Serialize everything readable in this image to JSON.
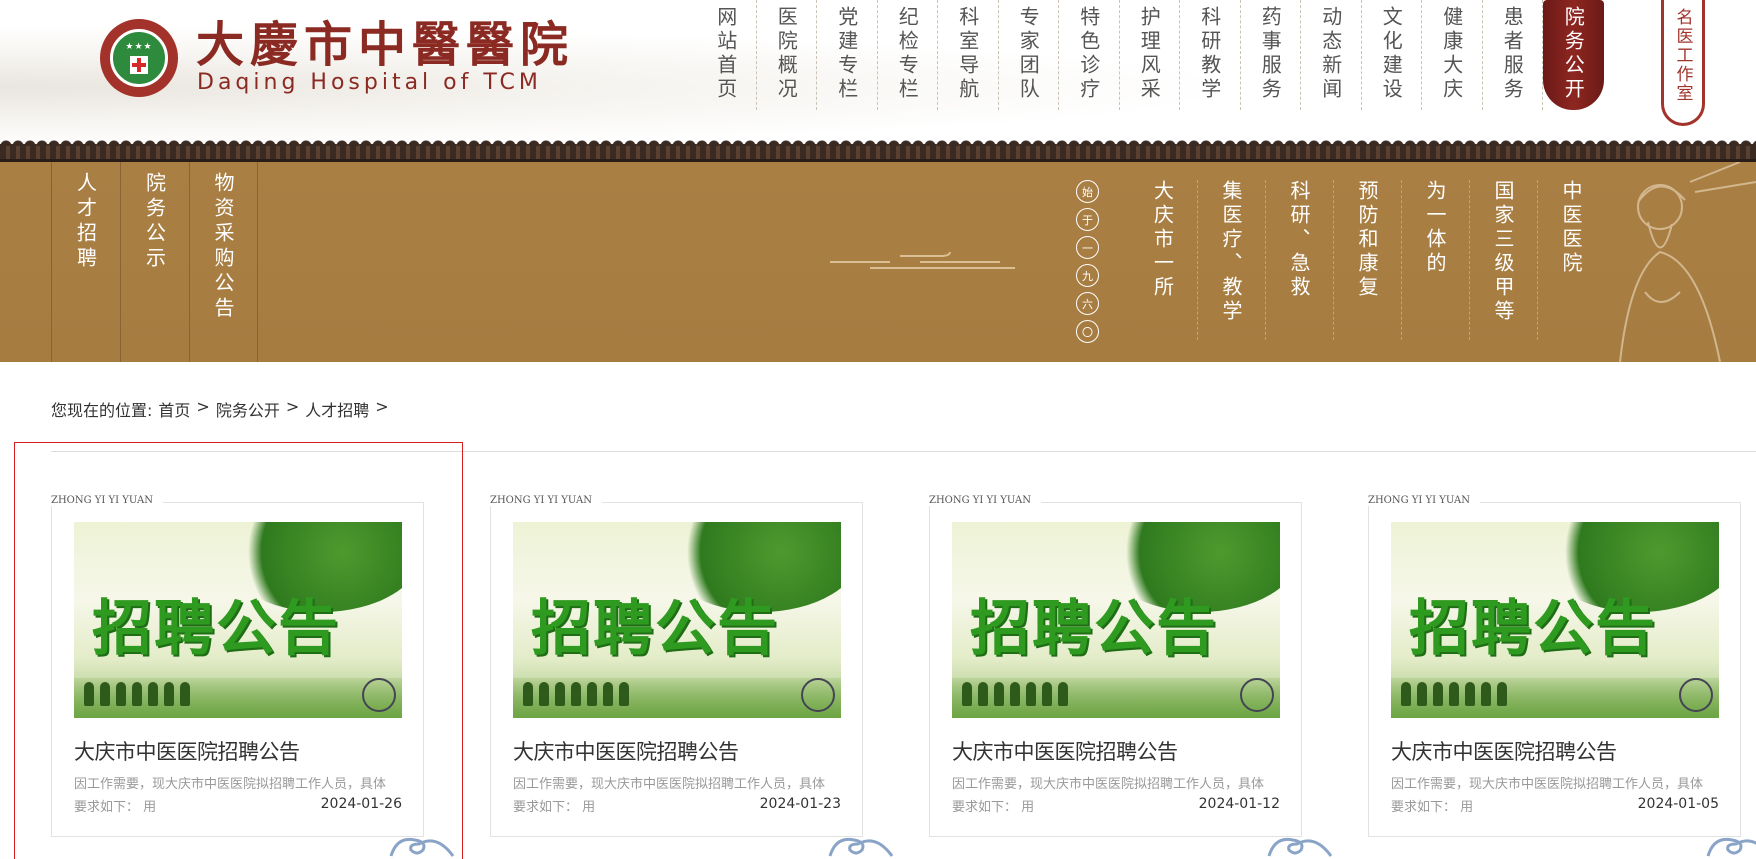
{
  "header": {
    "logo_cn": "大慶市中醫醫院",
    "logo_en": "Daqing Hospital of TCM",
    "nav": [
      "网站首页",
      "医院概况",
      "党建专栏",
      "纪检专栏",
      "科室导航",
      "专家团队",
      "特色诊疗",
      "护理风采",
      "科研教学",
      "药事服务",
      "动态新闻",
      "文化建设",
      "健康大庆",
      "患者服务",
      "院务公开"
    ],
    "active_nav": "院务公开",
    "stamp_label": "名医工作室"
  },
  "banner": {
    "subnav": [
      "人才招聘",
      "院务公示",
      "物资采购公告"
    ],
    "founded_glyphs": [
      "始",
      "于",
      "一",
      "九",
      "六",
      "〇"
    ],
    "poem": [
      "大庆市一所",
      "集医疗、教学",
      "科研、急救",
      "预防和康复",
      "为一体的",
      "国家三级甲等",
      "中医医院"
    ]
  },
  "breadcrumb": {
    "prefix": "您现在的位置:",
    "items": [
      "首页",
      "院务公开",
      "人才招聘"
    ],
    "separator": ">"
  },
  "cards": [
    {
      "tag": "ZHONG YI YI YUAN",
      "thumb_text": "招聘公告",
      "title": "大庆市中医医院招聘公告",
      "desc": "因工作需要，现大庆市中医医院拟招聘工作人员，具体要求如下： 用",
      "date": "2024-01-26"
    },
    {
      "tag": "ZHONG YI YI YUAN",
      "thumb_text": "招聘公告",
      "title": "大庆市中医医院招聘公告",
      "desc": "因工作需要，现大庆市中医医院拟招聘工作人员，具体要求如下： 用",
      "date": "2024-01-23"
    },
    {
      "tag": "ZHONG YI YI YUAN",
      "thumb_text": "招聘公告",
      "title": "大庆市中医医院招聘公告",
      "desc": "因工作需要，现大庆市中医医院拟招聘工作人员，具体要求如下： 用",
      "date": "2024-01-12"
    },
    {
      "tag": "ZHONG YI YI YUAN",
      "thumb_text": "招聘公告",
      "title": "大庆市中医医院招聘公告",
      "desc": "因工作需要，现大庆市中医医院拟招聘工作人员，具体要求如下： 用",
      "date": "2024-01-05"
    }
  ],
  "colors": {
    "brand_red": "#8b2a22",
    "banner_tan": "#a67c41",
    "highlight": "#d62020"
  }
}
